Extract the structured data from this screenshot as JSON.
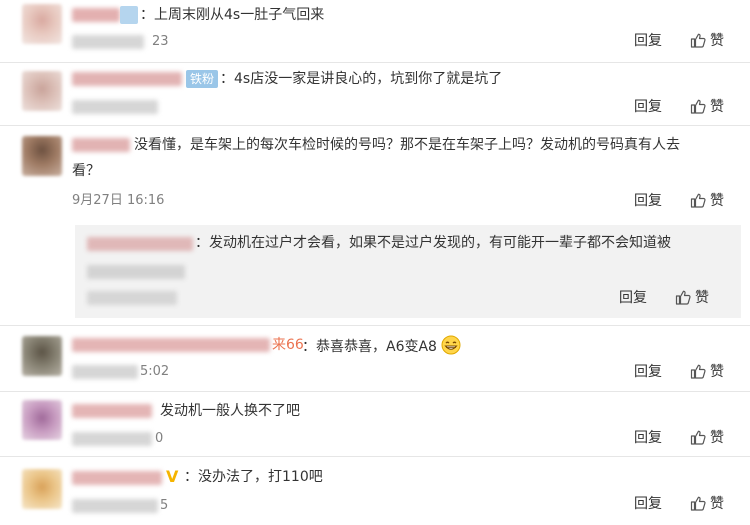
{
  "comments": [
    {
      "fan_badge": "",
      "text": "：上周末刚从4s一肚子气回来",
      "time_tail": "23",
      "reply_label": "回复",
      "like_label": "赞"
    },
    {
      "fan_badge": "铁粉",
      "text": "：4s店没一家是讲良心的，坑到你了就是坑了",
      "time_tail": "",
      "reply_label": "回复",
      "like_label": "赞"
    },
    {
      "text_line1": "没看懂，是车架上的每次车检时候的号吗？那不是在车架子上吗？发动机的号码真有人去",
      "text_line2": "看？",
      "time": "9月27日 16:16",
      "reply_label": "回复",
      "like_label": "赞"
    },
    {
      "sub_reply": {
        "text": "：发动机在过户才会看，如果不是过户发现的，有可能开一辈子都不会知道被",
        "reply_label": "回复",
        "like_label": "赞"
      }
    },
    {
      "name_tail": "来66",
      "text": "：恭喜恭喜，A6变A8",
      "time_tail": "5:02",
      "reply_label": "回复",
      "like_label": "赞"
    },
    {
      "text": "发动机一般人换不了吧",
      "time_tail": "0",
      "reply_label": "回复",
      "like_label": "赞"
    },
    {
      "verified_badge": "V",
      "text": "：没办法了，打110吧",
      "time_tail": "5",
      "reply_label": "回复",
      "like_label": "赞"
    }
  ],
  "colors": {
    "text": "#333333",
    "muted": "#808080",
    "badge_bg": "#9ac6e8",
    "verified": "#f5b400",
    "sub_bg": "#f2f2f2"
  },
  "icons": {
    "like": "thumbs-up-icon",
    "emoji": "grin-emoji-icon"
  }
}
